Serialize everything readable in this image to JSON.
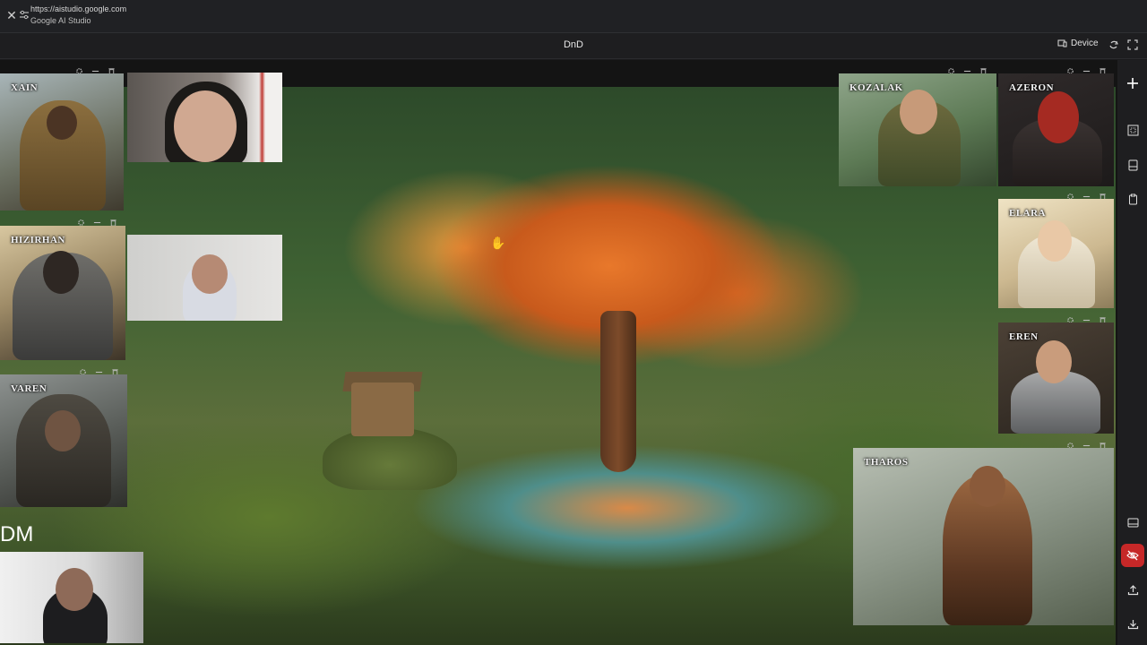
{
  "browser": {
    "url": "https://aistudio.google.com",
    "site_name": "Google AI Studio"
  },
  "toolbar": {
    "title": "DnD",
    "device_label": "Device"
  },
  "characters": [
    {
      "name": "XAIN"
    },
    {
      "name": "HIZIRHAN"
    },
    {
      "name": "VAREN"
    },
    {
      "name": "KOZALAK"
    },
    {
      "name": "AZERON"
    },
    {
      "name": "ELARA"
    },
    {
      "name": "EREN"
    },
    {
      "name": "THAROS"
    }
  ],
  "dm": {
    "label": "DM"
  },
  "colors": {
    "danger": "#c62828",
    "chrome_bg": "#202124",
    "toolbar_bg": "#1e1e20"
  },
  "icons": {
    "window_controls": [
      "gear-icon",
      "minimize-icon",
      "trash-icon"
    ],
    "right_toolbar": [
      "plus-icon",
      "frame-icon",
      "panel-icon",
      "clipboard-icon",
      "panel-bottom-icon",
      "eye-off-icon",
      "upload-icon",
      "download-icon"
    ]
  }
}
